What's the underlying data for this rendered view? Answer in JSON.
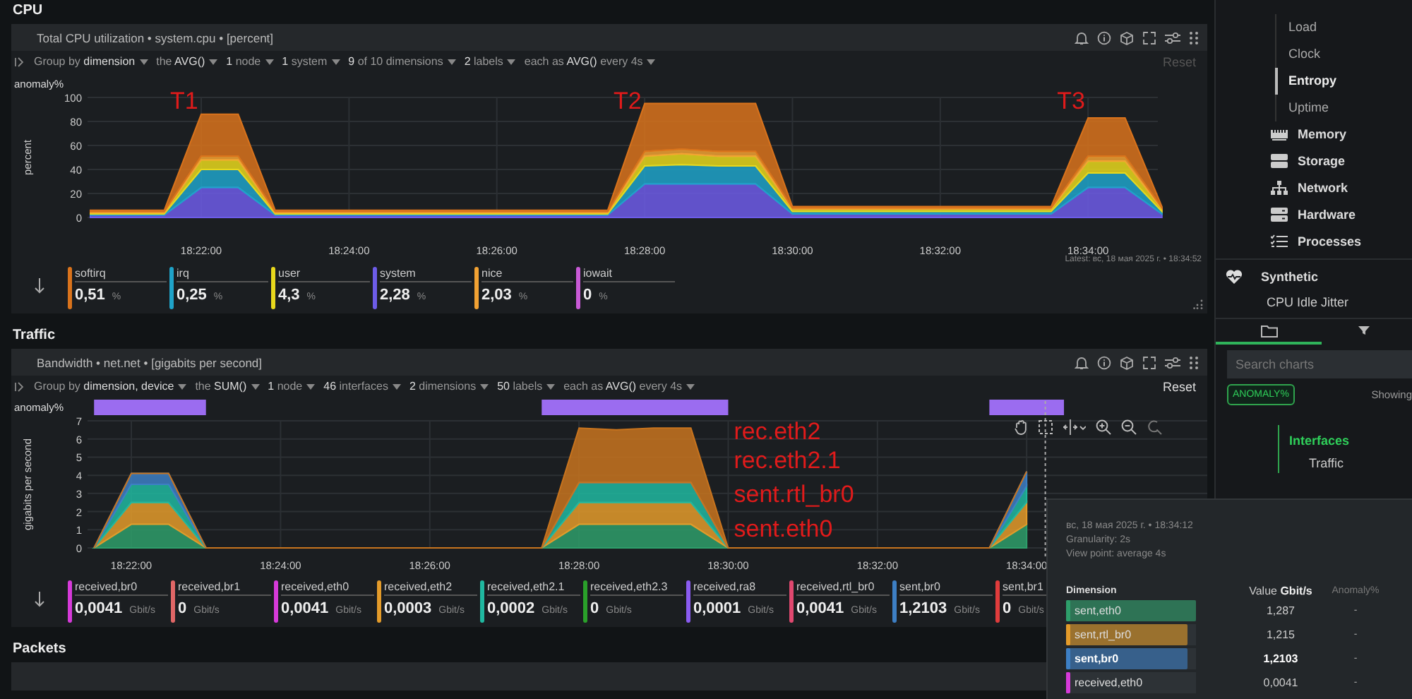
{
  "cpu": {
    "heading": "CPU",
    "panel": {
      "title": "Total CPU utilization • system.cpu • [percent]",
      "filters": [
        "Group by **dimension**",
        "the **AVG()**",
        "**1** node",
        "**1** system",
        "**9** of 10 dimensions",
        "**2** labels",
        "each as **AVG()** every 4s"
      ],
      "reset": {
        "label": "Reset",
        "disabled": true
      },
      "anomaly_label": "anomaly%",
      "latest": "Latest: вс, 18 мая 2025 г. • 18:34:52",
      "chart_data": {
        "type": "area",
        "stacked": true,
        "grid": true,
        "ylabel": "percent",
        "ylim": [
          0,
          100
        ],
        "yticks": [
          0,
          20,
          40,
          60,
          80,
          100
        ],
        "categories": [
          null,
          null,
          null,
          "18:22:00",
          null,
          null,
          null,
          "18:24:00",
          null,
          null,
          null,
          "18:26:00",
          null,
          null,
          null,
          "18:28:00",
          null,
          null,
          null,
          "18:30:00",
          null,
          null,
          null,
          "18:32:00",
          null,
          null,
          null,
          "18:34:00",
          null,
          null
        ],
        "series": [
          {
            "color": "#6d5ce8",
            "values": [
              2,
              2,
              2,
              25,
              25,
              2,
              2,
              2,
              2,
              2,
              2,
              2,
              2,
              2,
              2,
              28,
              28,
              28,
              28,
              3,
              3,
              3,
              3,
              3,
              3,
              3,
              3,
              25,
              25,
              3
            ]
          },
          {
            "color": "#1fa3c9",
            "values": [
              1,
              1,
              1,
              15,
              15,
              1,
              1,
              1,
              1,
              1,
              1,
              1,
              1,
              1,
              1,
              15,
              16,
              15,
              15,
              2,
              2,
              2,
              2,
              2,
              2,
              2,
              2,
              12,
              12,
              2
            ]
          },
          {
            "color": "#e8d81c",
            "values": [
              1,
              1,
              1,
              8,
              8,
              1,
              1,
              1,
              1,
              1,
              1,
              1,
              1,
              1,
              1,
              8,
              9,
              8,
              8,
              2,
              2,
              2,
              2,
              2,
              2,
              2,
              2,
              10,
              10,
              2
            ]
          },
          {
            "color": "#f2a233",
            "values": [
              1,
              1,
              1,
              3,
              3,
              1,
              1,
              1,
              1,
              1,
              1,
              1,
              1,
              1,
              1,
              4,
              4,
              4,
              4,
              1,
              1,
              1,
              1,
              1,
              1,
              1,
              1,
              4,
              4,
              1
            ]
          },
          {
            "color": "#d9731c",
            "values": [
              1,
              1,
              1,
              35,
              35,
              1,
              1,
              1,
              1,
              1,
              1,
              1,
              1,
              1,
              1,
              40,
              38,
              40,
              40,
              1,
              1,
              1,
              1,
              1,
              1,
              1,
              1,
              32,
              32,
              1
            ]
          }
        ],
        "annotations": [
          "T1",
          "T2",
          "T3"
        ]
      },
      "legend": [
        {
          "name": "softirq",
          "value": "0,51",
          "unit": "%",
          "color": "#d9731c"
        },
        {
          "name": "irq",
          "value": "0,25",
          "unit": "%",
          "color": "#1fa3c9"
        },
        {
          "name": "user",
          "value": "4,3",
          "unit": "%",
          "color": "#e8d81c"
        },
        {
          "name": "system",
          "value": "2,28",
          "unit": "%",
          "color": "#6d5ce8"
        },
        {
          "name": "nice",
          "value": "2,03",
          "unit": "%",
          "color": "#f2a233"
        },
        {
          "name": "iowait",
          "value": "0",
          "unit": "%",
          "color": "#c85ad6"
        }
      ]
    }
  },
  "traffic": {
    "heading": "Traffic",
    "panel": {
      "title": "Bandwidth • net.net • [gigabits per second]",
      "filters": [
        "Group by **dimension, device**",
        "the **SUM()**",
        "**1** node",
        "**46** interfaces",
        "**2** dimensions",
        "**50** labels",
        "each as **AVG()** every 4s"
      ],
      "reset": {
        "label": "Reset",
        "disabled": false
      },
      "anomaly_label": "anomaly%",
      "chart_data": {
        "type": "area",
        "stacked": true,
        "grid": true,
        "ylabel": "gigabits per second",
        "ylim": [
          0,
          7
        ],
        "yticks": [
          0,
          1,
          2,
          3,
          4,
          5,
          6,
          7
        ],
        "categories": [
          null,
          "18:22:00",
          null,
          null,
          null,
          "18:24:00",
          null,
          null,
          null,
          "18:26:00",
          null,
          null,
          null,
          "18:28:00",
          null,
          null,
          null,
          "18:30:00",
          null,
          null,
          null,
          "18:32:00",
          null,
          null,
          null,
          "18:34:00"
        ],
        "series": [
          {
            "color": "#2e9e6a",
            "values": [
              0,
              1.3,
              1.3,
              0,
              0,
              0,
              0,
              0,
              0,
              0,
              0,
              0,
              0,
              1.3,
              1.3,
              1.3,
              1.3,
              0,
              0,
              0,
              0,
              0,
              0,
              0,
              0,
              1.29
            ]
          },
          {
            "color": "#e39b2a",
            "values": [
              0,
              1.2,
              1.2,
              0,
              0,
              0,
              0,
              0,
              0,
              0,
              0,
              0,
              0,
              1.2,
              1.2,
              1.2,
              1.2,
              0,
              0,
              0,
              0,
              0,
              0,
              0,
              0,
              1.22
            ]
          },
          {
            "color": "#20b8a0",
            "values": [
              0,
              1.0,
              1.0,
              0,
              0,
              0,
              0,
              0,
              0,
              0,
              0,
              0,
              0,
              1.1,
              1.1,
              1.1,
              1.1,
              0,
              0,
              0,
              0,
              0,
              0,
              0,
              0,
              0.9
            ]
          },
          {
            "color": "#3d7fc4",
            "values": [
              0,
              0.6,
              0.6,
              0,
              0,
              0,
              0,
              0,
              0,
              0,
              0,
              0,
              0,
              0,
              0,
              0,
              0,
              0,
              0,
              0,
              0,
              0,
              0,
              0,
              0,
              0.8
            ]
          },
          {
            "color": "#c8741e",
            "values": [
              0,
              0,
              0,
              0,
              0,
              0,
              0,
              0,
              0,
              0,
              0,
              0,
              0,
              3.0,
              2.9,
              3.0,
              3.0,
              0,
              0,
              0,
              0,
              0,
              0,
              0,
              0,
              0
            ]
          }
        ],
        "annotations": [
          "rec.eth2",
          "rec.eth2.1",
          "sent.rtl_br0",
          "sent.eth0"
        ]
      },
      "legend": [
        {
          "name": "received,br0",
          "value": "0,0041",
          "unit": "Gbit/s",
          "color": "#d63ad9"
        },
        {
          "name": "received,br1",
          "value": "0",
          "unit": "Gbit/s",
          "color": "#e06666"
        },
        {
          "name": "received,eth0",
          "value": "0,0041",
          "unit": "Gbit/s",
          "color": "#d63ad9"
        },
        {
          "name": "received,eth2",
          "value": "0,0003",
          "unit": "Gbit/s",
          "color": "#e39b2a"
        },
        {
          "name": "received,eth2.1",
          "value": "0,0002",
          "unit": "Gbit/s",
          "color": "#20b8a0"
        },
        {
          "name": "received,eth2.3",
          "value": "0",
          "unit": "Gbit/s",
          "color": "#2aa02a"
        },
        {
          "name": "received,ra8",
          "value": "0,0001",
          "unit": "Gbit/s",
          "color": "#8a5cf0"
        },
        {
          "name": "received,rtl_br0",
          "value": "0,0041",
          "unit": "Gbit/s",
          "color": "#e0486f"
        },
        {
          "name": "sent,br0",
          "value": "1,2103",
          "unit": "Gbit/s",
          "color": "#3d7fc4"
        },
        {
          "name": "sent,br1",
          "value": "0",
          "unit": "Gbit/s",
          "color": "#e03c3c"
        }
      ]
    }
  },
  "packets": {
    "heading": "Packets"
  },
  "sidebar": {
    "sub_items": [
      {
        "label": "Load",
        "selected": false
      },
      {
        "label": "Clock",
        "selected": false
      },
      {
        "label": "Entropy",
        "selected": true
      },
      {
        "label": "Uptime",
        "selected": false
      }
    ],
    "groups": [
      "Memory",
      "Storage",
      "Network",
      "Hardware",
      "Processes"
    ],
    "synthetic": {
      "title": "Synthetic",
      "items": [
        "CPU Idle Jitter"
      ]
    },
    "tabs": [
      {
        "selected": true
      },
      {
        "selected": false
      }
    ],
    "search": {
      "placeholder": "Search charts"
    },
    "badge": "ANOMALY%",
    "showing": "Showing",
    "tree": {
      "title": "Interfaces",
      "items": [
        "Traffic"
      ]
    }
  },
  "tooltip": {
    "time": "вс, 18 мая 2025 г. • 18:34:12",
    "granularity": "Granularity: 2s",
    "view_point": "View point: average 4s",
    "columns": [
      "Dimension",
      "Value **Gbit/s**",
      "Anomaly%"
    ],
    "rows": [
      {
        "name": "sent,eth0",
        "value": "1,287",
        "anomaly": "-",
        "color": "#2e9e6a",
        "level": 1,
        "selected": false
      },
      {
        "name": "sent,rtl_br0",
        "value": "1,215",
        "anomaly": "-",
        "color": "#e39b2a",
        "level": 0.94,
        "selected": false
      },
      {
        "name": "sent,br0",
        "value": "1,2103",
        "anomaly": "-",
        "color": "#3d7fc4",
        "level": 0.94,
        "selected": true
      },
      {
        "name": "received,eth0",
        "value": "0,0041",
        "anomaly": "-",
        "color": "#d63ad9",
        "level": 0.003,
        "selected": false
      }
    ]
  }
}
